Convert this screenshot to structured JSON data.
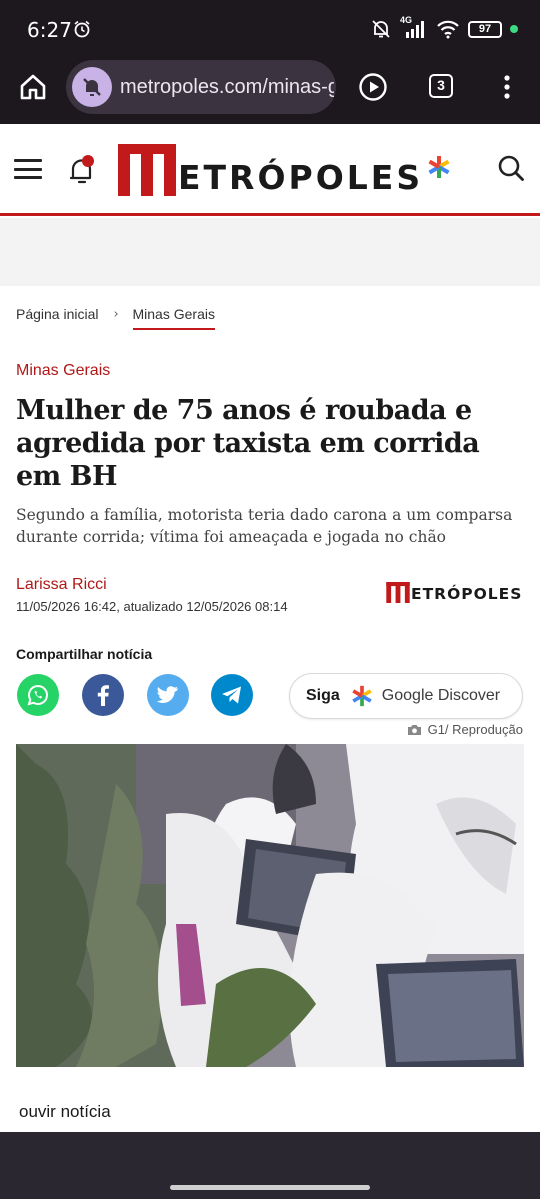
{
  "status_bar": {
    "time": "6:27",
    "network": "4G",
    "battery": "97"
  },
  "browser": {
    "url": "metropoles.com/minas-g",
    "tab_count": "3"
  },
  "site": {
    "logo_text": "ETRÓPOLES"
  },
  "breadcrumb": {
    "home": "Página inicial",
    "separator": ">",
    "current": "Minas Gerais"
  },
  "article": {
    "section": "Minas Gerais",
    "title": "Mulher de 75 anos é roubada e agredida por taxista em corrida em BH",
    "subtitle": "Segundo a família, motorista teria dado carona a um comparsa durante corrida; vítima foi ameaçada e jogada no chão",
    "author": "Larissa Ricci",
    "dates": "11/05/2026 16:42, atualizado 12/05/2026 08:14",
    "publisher_logo_text": "ETRÓPOLES"
  },
  "share": {
    "label": "Compartilhar notícia",
    "buttons": [
      {
        "name": "whatsapp",
        "color": "#25d366"
      },
      {
        "name": "facebook",
        "color": "#3b5998"
      },
      {
        "name": "twitter",
        "color": "#55acee"
      },
      {
        "name": "telegram",
        "color": "#0088cc"
      }
    ],
    "follow_prefix": "Siga",
    "follow_target": "Google Discover"
  },
  "photo": {
    "credit": "G1/ Reprodução"
  },
  "audio": {
    "label": "ouvir notícia"
  },
  "colors": {
    "brand_red": "#c21a1a",
    "section_red": "#b01818",
    "browser_bg": "#1c181d"
  },
  "icons": [
    "alarm-icon",
    "mute-icon",
    "signal-icon",
    "wifi-icon",
    "home-icon",
    "play-icon",
    "more-icon",
    "menu-icon",
    "bell-icon",
    "search-icon",
    "camera-icon"
  ]
}
